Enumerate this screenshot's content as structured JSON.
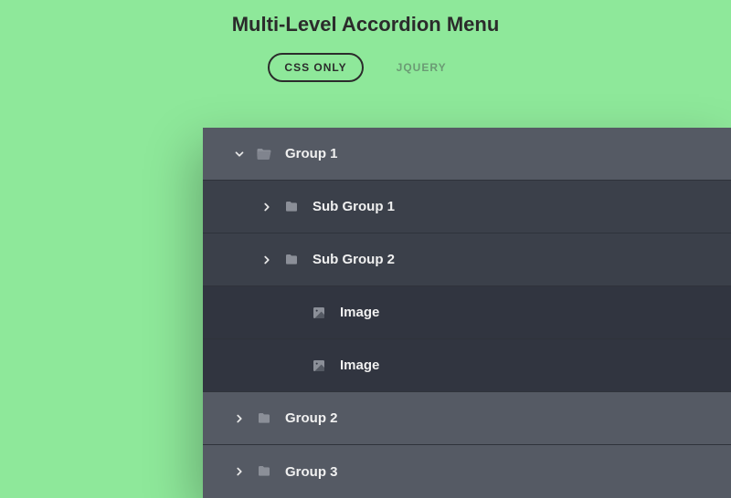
{
  "title": "Multi-Level Accordion Menu",
  "tabs": {
    "css": "CSS ONLY",
    "jquery": "JQUERY"
  },
  "menu": {
    "group1": "Group 1",
    "sub1": "Sub Group 1",
    "sub2": "Sub Group 2",
    "img1": "Image",
    "img2": "Image",
    "group2": "Group 2",
    "group3": "Group 3"
  }
}
